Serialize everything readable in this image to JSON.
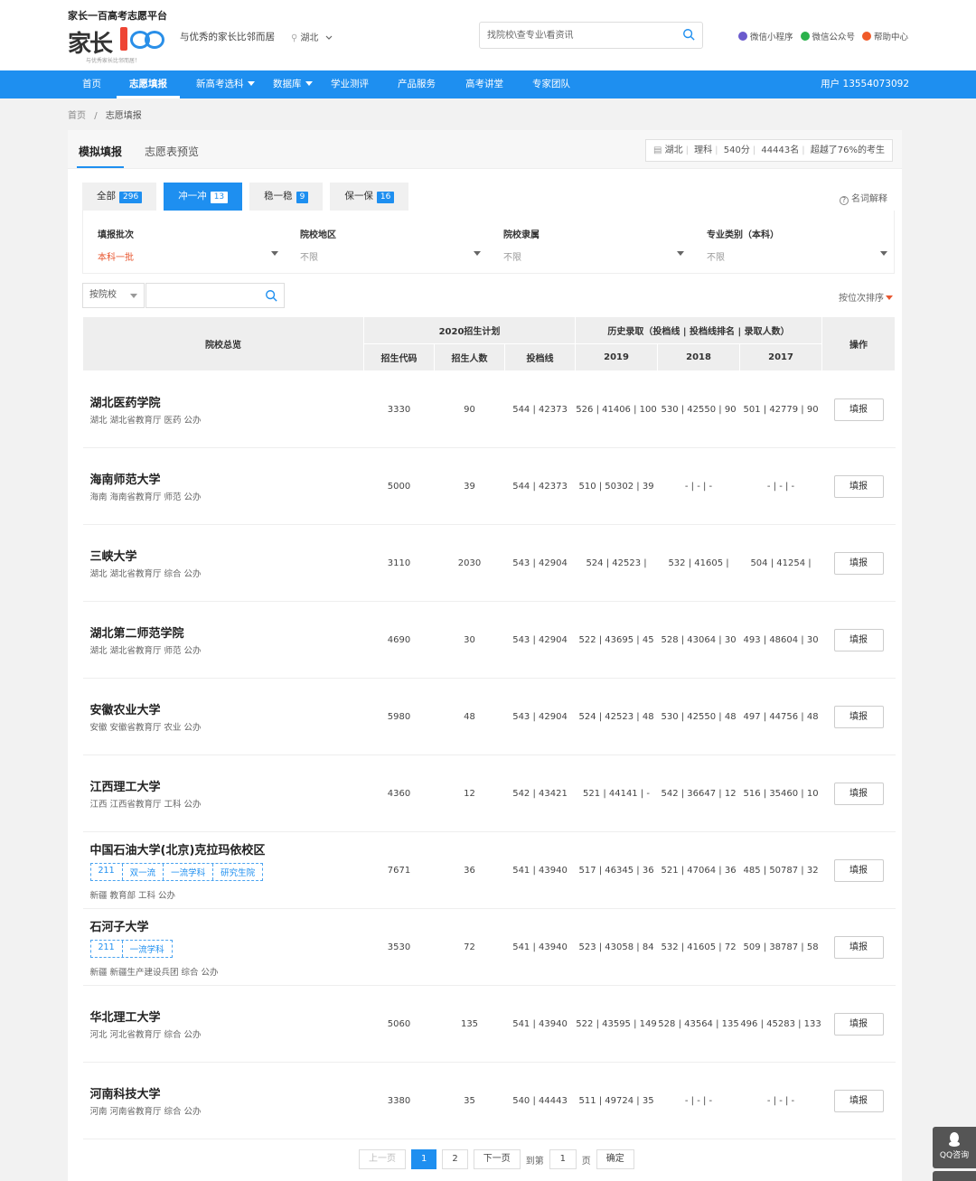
{
  "header": {
    "platform_name": "家长一百高考志愿平台",
    "logo_text": "家长",
    "logo_sub": "与优秀家长比邻而居！",
    "slogan": "与优秀的家长比邻而居",
    "location": "湖北",
    "search_placeholder": "找院校\\查专业\\看资讯",
    "links": [
      {
        "label": "微信小程序",
        "color": "#6a5acd"
      },
      {
        "label": "微信公众号",
        "color": "#2bb24c"
      },
      {
        "label": "帮助中心",
        "color": "#f05a28"
      }
    ]
  },
  "nav": {
    "items": [
      "首页",
      "志愿填报",
      "新高考选科",
      "数据库",
      "学业测评",
      "产品服务",
      "高考讲堂",
      "专家团队"
    ],
    "active": "志愿填报",
    "user": "用户 13554073092"
  },
  "breadcrumb": {
    "home": "首页",
    "sep": "/",
    "current": "志愿填报"
  },
  "tabs": {
    "simulate": "模拟填报",
    "preview": "志愿表预览"
  },
  "info": {
    "province": "湖北",
    "subject": "理科",
    "score": "540分",
    "rank": "44443名",
    "exceed": "超越了76%的考生"
  },
  "filter_tabs": [
    {
      "label": "全部",
      "count": "296"
    },
    {
      "label": "冲一冲",
      "count": "13"
    },
    {
      "label": "稳一稳",
      "count": "9"
    },
    {
      "label": "保一保",
      "count": "16"
    }
  ],
  "glossary": "名词解释",
  "filters": [
    {
      "label": "填报批次",
      "value": "本科一批"
    },
    {
      "label": "院校地区",
      "value": "不限"
    },
    {
      "label": "院校隶属",
      "value": "不限"
    },
    {
      "label": "专业类别（本科）",
      "value": "不限"
    }
  ],
  "sort_select": "按院校",
  "rank_order": "按位次排序",
  "table": {
    "h_overview": "院校总览",
    "h_plan": "2020招生计划",
    "h_history": "历史录取（投档线 | 投档线排名 | 录取人数）",
    "h_action": "操作",
    "h_code": "招生代码",
    "h_count": "招生人数",
    "h_line": "投档线",
    "h_2019": "2019",
    "h_2018": "2018",
    "h_2017": "2017",
    "fill_label": "填报",
    "rows": [
      {
        "name": "湖北医药学院",
        "meta": "湖北  湖北省教育厅  医药  公办",
        "tags": [],
        "code": "3330",
        "count": "90",
        "line": "544 | 42373",
        "y2019": "526 | 41406 | 100",
        "y2018": "530 | 42550 | 90",
        "y2017": "501 | 42779 | 90"
      },
      {
        "name": "海南师范大学",
        "meta": "海南  海南省教育厅  师范  公办",
        "tags": [],
        "code": "5000",
        "count": "39",
        "line": "544 | 42373",
        "y2019": "510 | 50302 | 39",
        "y2018": "- | - | -",
        "y2017": "- | - | -"
      },
      {
        "name": "三峡大学",
        "meta": "湖北  湖北省教育厅  综合  公办",
        "tags": [],
        "code": "3110",
        "count": "2030",
        "line": "543 | 42904",
        "y2019": "524 | 42523 |",
        "y2018": "532 | 41605 |",
        "y2017": "504 | 41254 |"
      },
      {
        "name": "湖北第二师范学院",
        "meta": "湖北  湖北省教育厅  师范  公办",
        "tags": [],
        "code": "4690",
        "count": "30",
        "line": "543 | 42904",
        "y2019": "522 | 43695 | 45",
        "y2018": "528 | 43064 | 30",
        "y2017": "493 | 48604 | 30"
      },
      {
        "name": "安徽农业大学",
        "meta": "安徽  安徽省教育厅  农业  公办",
        "tags": [],
        "code": "5980",
        "count": "48",
        "line": "543 | 42904",
        "y2019": "524 | 42523 | 48",
        "y2018": "530 | 42550 | 48",
        "y2017": "497 | 44756 | 48"
      },
      {
        "name": "江西理工大学",
        "meta": "江西  江西省教育厅  工科  公办",
        "tags": [],
        "code": "4360",
        "count": "12",
        "line": "542 | 43421",
        "y2019": "521 | 44141 | -",
        "y2018": "542 | 36647 | 12",
        "y2017": "516 | 35460 | 10"
      },
      {
        "name": "中国石油大学(北京)克拉玛依校区",
        "meta": "新疆  教育部  工科  公办",
        "tags": [
          "211",
          "双一流",
          "一流学科",
          "研究生院"
        ],
        "code": "7671",
        "count": "36",
        "line": "541 | 43940",
        "y2019": "517 | 46345 | 36",
        "y2018": "521 | 47064 | 36",
        "y2017": "485 | 50787 | 32"
      },
      {
        "name": "石河子大学",
        "meta": "新疆  新疆生产建设兵团  综合  公办",
        "tags": [
          "211",
          "一流学科"
        ],
        "code": "3530",
        "count": "72",
        "line": "541 | 43940",
        "y2019": "523 | 43058 | 84",
        "y2018": "532 | 41605 | 72",
        "y2017": "509 | 38787 | 58"
      },
      {
        "name": "华北理工大学",
        "meta": "河北  河北省教育厅  综合  公办",
        "tags": [],
        "code": "5060",
        "count": "135",
        "line": "541 | 43940",
        "y2019": "522 | 43595 | 149",
        "y2018": "528 | 43564 | 135",
        "y2017": "496 | 45283 | 133"
      },
      {
        "name": "河南科技大学",
        "meta": "河南  河南省教育厅  综合  公办",
        "tags": [],
        "code": "3380",
        "count": "35",
        "line": "540 | 44443",
        "y2019": "511 | 49724 | 35",
        "y2018": "- | - | -",
        "y2017": "- | - | -"
      }
    ]
  },
  "pager": {
    "prev": "上一页",
    "pages": [
      "1",
      "2"
    ],
    "current": "1",
    "next": "下一页",
    "goto": "到第",
    "goto_value": "1",
    "page_unit": "页",
    "confirm": "确定"
  },
  "qq": "QQ咨询"
}
